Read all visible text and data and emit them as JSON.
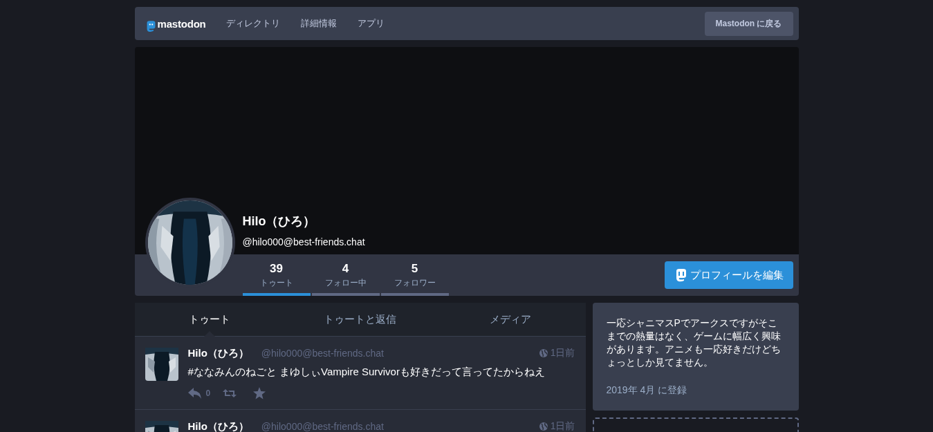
{
  "nav": {
    "logo_text": "mastodon",
    "links": [
      "ディレクトリ",
      "詳細情報",
      "アプリ"
    ],
    "back_button": "Mastodon に戻る"
  },
  "profile": {
    "name": "Hilo（ひろ）",
    "handle": "@hilo000@best-friends.chat",
    "edit_button": "プロフィールを編集",
    "counters": [
      {
        "value": "39",
        "label": "トゥート",
        "selected": true
      },
      {
        "value": "4",
        "label": "フォロー中",
        "selected": false
      },
      {
        "value": "5",
        "label": "フォロワー",
        "selected": false
      }
    ]
  },
  "tabs": [
    {
      "label": "トゥート",
      "selected": true
    },
    {
      "label": "トゥートと返信",
      "selected": false
    },
    {
      "label": "メディア",
      "selected": false
    }
  ],
  "statuses": [
    {
      "name": "Hilo（ひろ）",
      "handle": "@hilo000@best-friends.chat",
      "time": "1日前",
      "content": "#ななみんのねごと まゆしぃVampire Survivorも好きだって言ってたからねえ",
      "replies": "0"
    },
    {
      "name": "Hilo（ひろ）",
      "handle": "@hilo000@best-friends.chat",
      "time": "1日前"
    }
  ],
  "bio": {
    "text": "一応シャニマスPでアークスですがそこまでの熱量はなく、ゲームに幅広く興味があります。アニメも一応好きだけどちょっとしか見てません。",
    "joined": "2019年 4月 に登録"
  }
}
